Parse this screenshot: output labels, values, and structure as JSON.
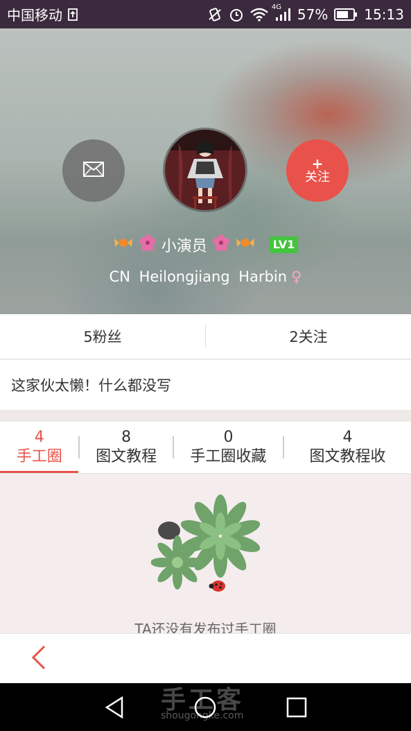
{
  "status_bar": {
    "carrier": "中国移动",
    "network": "4G",
    "battery": "57%",
    "time": "15:13"
  },
  "profile": {
    "username": "小演员",
    "level": "LV1",
    "location": "CN Heilongjiang Harbin",
    "gender_symbol": "♀",
    "follow_plus": "+",
    "follow_label": "关注"
  },
  "stats": {
    "fans": "5粉丝",
    "following": "2关注"
  },
  "bio": "这家伙太懒！什么都没写",
  "tabs": [
    {
      "count": "4",
      "label": "手工圈"
    },
    {
      "count": "8",
      "label": "图文教程"
    },
    {
      "count": "0",
      "label": "手工圈收藏"
    },
    {
      "count": "4",
      "label": "图文教程收"
    }
  ],
  "empty_state": "TA还没有发布过手工圈",
  "watermark": {
    "logo": "手工客",
    "url": "shougongke.com"
  },
  "colors": {
    "accent": "#e9524a",
    "level": "#43c43d"
  }
}
